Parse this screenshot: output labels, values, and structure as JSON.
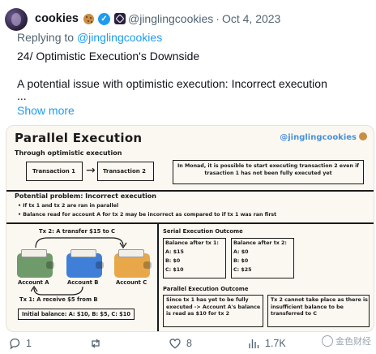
{
  "tweet": {
    "display_name": "cookies",
    "handle": "@jinglingcookies",
    "separator": "·",
    "date": "Oct 4, 2023",
    "replying_prefix": "Replying to ",
    "replying_to": "@jinglingcookies",
    "line1": "24/ Optimistic Execution's Downside",
    "line2": "A potential issue with optimistic execution: Incorrect execution",
    "ellipsis": "...",
    "show_more": "Show more"
  },
  "card": {
    "title": "Parallel Execution",
    "brand": "@jinglingcookies",
    "subtitle": "Through optimistic execution",
    "tx1": "Transaction 1",
    "arrow": "→",
    "tx2": "Transaction 2",
    "note": "In Monad, it is possible to start executing transaction 2 even if trasaction 1 has not been fully executed yet",
    "problem_title": "Potential problem: Incorrect execution",
    "bullet1": "• If tx 1 and tx 2 are ran in parallel",
    "bullet2": "• Balance read for account A for tx 2 may be incorrect as compared to if tx 1 was ran first",
    "tx2_label": "Tx 2: A transfer $15 to C",
    "account_a": "Account A",
    "account_b": "Account B",
    "account_c": "Account C",
    "tx1_label": "Tx 1: A receive $5 from B",
    "initial_balance": "Initial balance: A: $10, B: $5, C: $10",
    "serial_title": "Serial Execution Outcome",
    "after_tx1_title": "Balance after tx 1:",
    "after_tx1_lines": [
      "A: $15",
      "B: $0",
      "C: $10"
    ],
    "after_tx2_title": "Balance after tx 2:",
    "after_tx2_lines": [
      "A: $0",
      "B: $0",
      "C: $25"
    ],
    "parallel_title": "Parallel Execution Outcome",
    "parallel_left": "Since tx 1 has yet to be fully executed -> Account A's balance is read as $10 for tx 2",
    "parallel_right": "Tx 2 cannot take place as there is insufficient balance to be transferred to C",
    "colors": {
      "wallet_a": "#6f9a6a",
      "wallet_b": "#3f7fd8",
      "wallet_c": "#e8a84a",
      "brand": "#4a90d9"
    }
  },
  "actions": {
    "reply_count": "1",
    "retweet_count": "",
    "like_count": "8",
    "views_count": "1.7K",
    "icons": [
      "reply-icon",
      "retweet-icon",
      "like-icon",
      "views-icon",
      "bookmark-icon"
    ]
  },
  "watermark": {
    "text": "金色财经"
  }
}
